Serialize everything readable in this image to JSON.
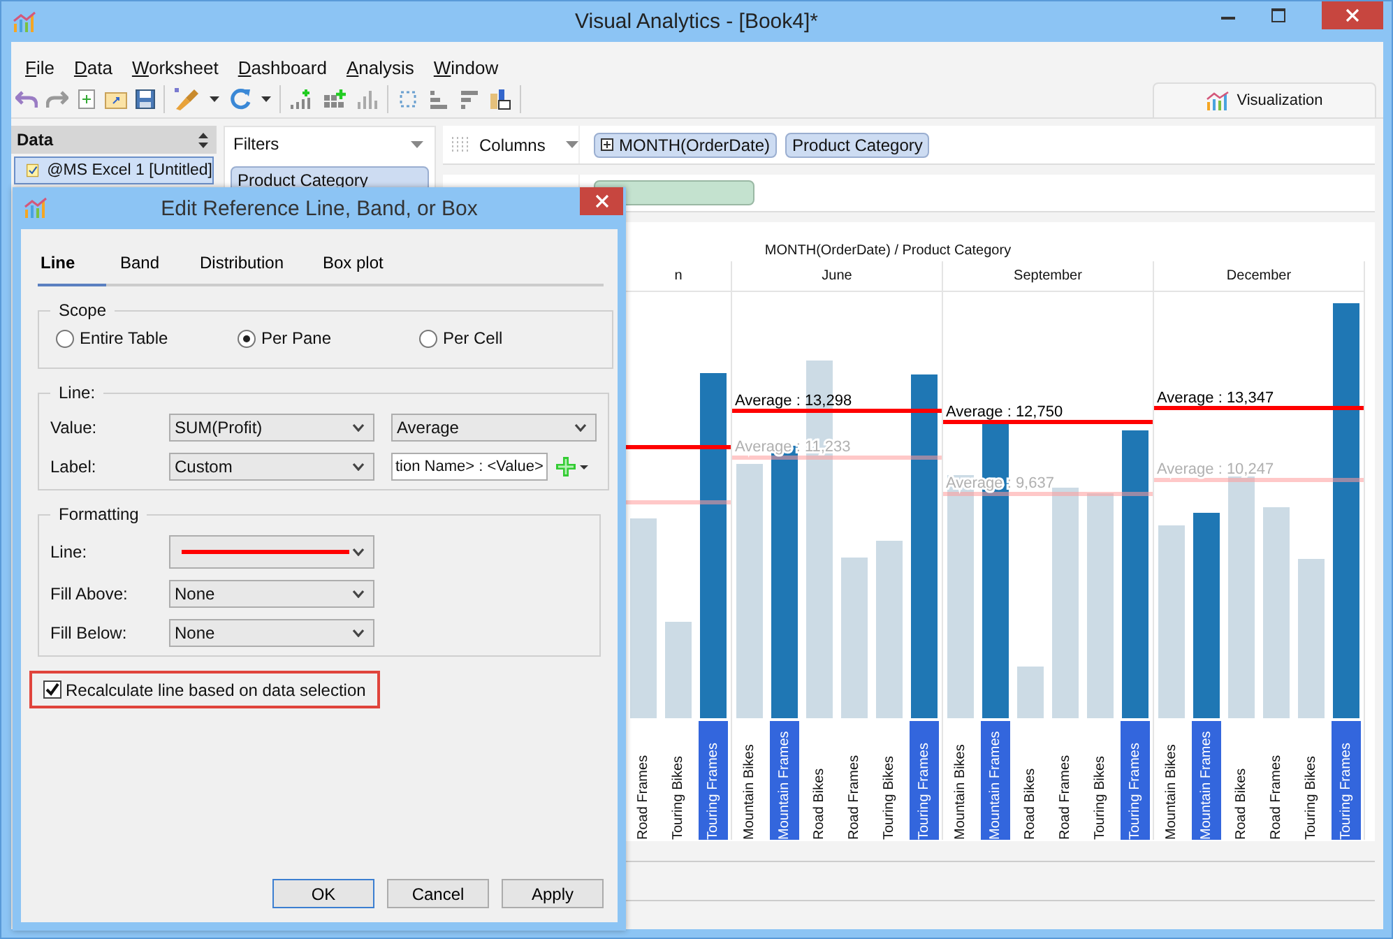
{
  "window": {
    "title": "Visual Analytics - [Book4]*"
  },
  "menu": [
    "File",
    "Data",
    "Worksheet",
    "Dashboard",
    "Analysis",
    "Window"
  ],
  "views": [
    {
      "label": "Visualization",
      "selected": true
    }
  ],
  "data_panel": {
    "title": "Data",
    "sources": [
      {
        "label": "@MS Excel 1 [Untitled]",
        "selected": true
      }
    ]
  },
  "filters": {
    "title": "Filters",
    "pills": [
      {
        "label": "Product Category",
        "kind": "dimension"
      }
    ]
  },
  "columns_shelf": {
    "title": "Columns",
    "pills": [
      {
        "label": "MONTH(OrderDate)",
        "kind": "date"
      },
      {
        "label": "Product Category",
        "kind": "dimension"
      }
    ]
  },
  "rows_shelf": {
    "pills": [
      {
        "kind": "measure"
      }
    ]
  },
  "chart": {
    "title": "MONTH(OrderDate) / Product Category",
    "panes": [
      {
        "header": "n",
        "categories": [
          {
            "label": "Road Frames",
            "selected": false
          },
          {
            "label": "Touring Bikes",
            "selected": false
          },
          {
            "label": "Touring Frames",
            "selected": true
          }
        ]
      },
      {
        "header": "June",
        "average_label": "Average : 13,298",
        "faded_average_label": "Average : 11,233",
        "categories": [
          {
            "label": "Mountain Bikes",
            "selected": false
          },
          {
            "label": "Mountain Frames",
            "selected": true
          },
          {
            "label": "Road Bikes",
            "selected": false
          },
          {
            "label": "Road Frames",
            "selected": false
          },
          {
            "label": "Touring Bikes",
            "selected": false
          },
          {
            "label": "Touring Frames",
            "selected": true
          }
        ]
      },
      {
        "header": "September",
        "average_label": "Average : 12,750",
        "faded_average_label": "Average : 9,637",
        "categories": [
          {
            "label": "Mountain Bikes",
            "selected": false
          },
          {
            "label": "Mountain Frames",
            "selected": true
          },
          {
            "label": "Road Bikes",
            "selected": false
          },
          {
            "label": "Road Frames",
            "selected": false
          },
          {
            "label": "Touring Bikes",
            "selected": false
          },
          {
            "label": "Touring Frames",
            "selected": true
          }
        ]
      },
      {
        "header": "December",
        "average_label": "Average : 13,347",
        "faded_average_label": "Average : 10,247",
        "categories": [
          {
            "label": "Mountain Bikes",
            "selected": false
          },
          {
            "label": "Mountain Frames",
            "selected": true
          },
          {
            "label": "Road Bikes",
            "selected": false
          },
          {
            "label": "Road Frames",
            "selected": false
          },
          {
            "label": "Touring Bikes",
            "selected": false
          },
          {
            "label": "Touring Frames",
            "selected": true
          }
        ]
      }
    ]
  },
  "dialog": {
    "title": "Edit Reference Line, Band, or Box",
    "tabs": [
      {
        "label": "Line",
        "selected": true
      },
      {
        "label": "Band",
        "selected": false
      },
      {
        "label": "Distribution",
        "selected": false
      },
      {
        "label": "Box plot",
        "selected": false
      }
    ],
    "scope": {
      "title": "Scope",
      "options": [
        {
          "label": "Entire Table",
          "selected": false
        },
        {
          "label": "Per Pane",
          "selected": true
        },
        {
          "label": "Per Cell",
          "selected": false
        }
      ]
    },
    "line": {
      "title": "Line:",
      "value_label": "Value:",
      "value": "SUM(Profit)",
      "aggregation": "Average",
      "label_label": "Label:",
      "label": "Custom",
      "label_text": "tion Name> : <Value>"
    },
    "formatting": {
      "title": "Formatting",
      "rows": [
        {
          "label": "Line:",
          "kind": "line-style"
        },
        {
          "label": "Fill Above:",
          "kind": "dropdown",
          "value": "None"
        },
        {
          "label": "Fill Below:",
          "kind": "dropdown",
          "value": "None"
        }
      ]
    },
    "recalculate": {
      "label": "Recalculate line based on data selection",
      "checked": true
    },
    "buttons": [
      {
        "label": "OK",
        "default": true
      },
      {
        "label": "Cancel",
        "default": false
      },
      {
        "label": "Apply",
        "default": false
      }
    ]
  }
}
